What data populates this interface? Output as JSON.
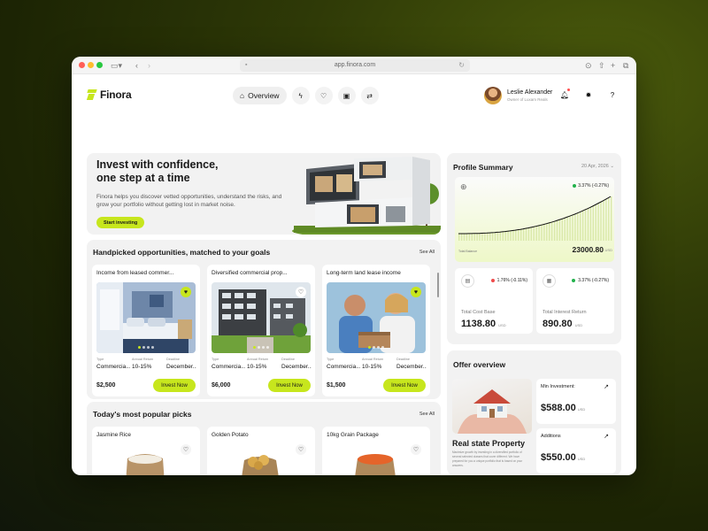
{
  "browser": {
    "url": "app.finora.com"
  },
  "app": {
    "brand": "Finora",
    "nav": {
      "overview": "Overview",
      "icons": [
        "lightning-icon",
        "heart-icon",
        "wallet-icon",
        "swap-icon"
      ]
    },
    "user": {
      "name": "Leslie Alexander",
      "role": "Owner of Luxam Reals"
    }
  },
  "hero": {
    "title": "Invest with confidence, one step at a time",
    "description": "Finora helps you discover vetted opportunities, understand the risks, and grow your portfolio without getting lost in market noise.",
    "cta": "Start investing"
  },
  "opportunities": {
    "title": "Handpicked opportunities, matched to your goals",
    "see_all": "See All",
    "labels": {
      "type": "Type",
      "annual_return": "Annual Return",
      "deadline": "Deadline",
      "invest": "Invest Now"
    },
    "cards": [
      {
        "title": "Income from leased commer...",
        "type": "Commercia...",
        "annual_return": "10-15%",
        "deadline": "December...",
        "price": "$2,500",
        "favorited": true
      },
      {
        "title": "Diversified commercial prop...",
        "type": "Commercia...",
        "annual_return": "10-15%",
        "deadline": "December...",
        "price": "$6,000",
        "favorited": false
      },
      {
        "title": "Long-term land lease income",
        "type": "Commercia...",
        "annual_return": "10-15%",
        "deadline": "December...",
        "price": "$1,500",
        "favorited": true
      }
    ]
  },
  "popular": {
    "title": "Today's most popular picks",
    "see_all": "See All",
    "items": [
      "Jasmine Rice",
      "Golden Potato",
      "10kg Grain Package"
    ]
  },
  "profile_summary": {
    "title": "Profile Summary",
    "date": "20 Apr, 2026",
    "change": "3.37% (-0.27%)",
    "total_balance_label": "Total Balance",
    "total_balance": "23000.80",
    "currency": "USD",
    "stats": [
      {
        "label": "Total Cost Base",
        "value": "1138.80",
        "unit": "USD",
        "change": "1.76% (-0.11%)",
        "status_color": "#ef4b4b"
      },
      {
        "label": "Total Interest Return",
        "value": "890.80",
        "unit": "USD",
        "change": "3.37% (-0.27%)",
        "status_color": "#22b24c"
      }
    ],
    "accent": "#c7e61d"
  },
  "offer": {
    "title": "Offer overview",
    "property_name": "Real state Property",
    "description": "Maximize growth by investing in a diversified portfolio of several selected classes that cover different. We have prepared for you a unique portfolio that is based on your answers.",
    "items": [
      {
        "label": "Min Investment:",
        "value": "$588.00",
        "unit": "USD"
      },
      {
        "label": "Additions",
        "value": "$550.00",
        "unit": "USD"
      }
    ]
  }
}
